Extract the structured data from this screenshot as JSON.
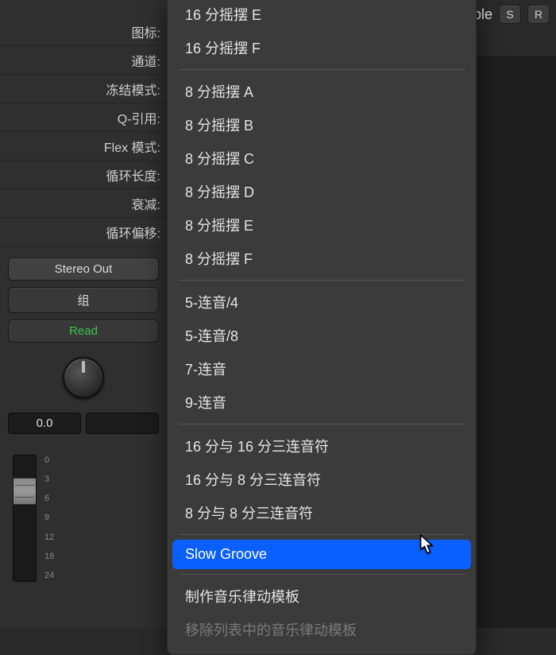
{
  "header": {
    "partial_title": "nt Maple",
    "solo_label": "S",
    "record_label": "R"
  },
  "panel": {
    "labels": {
      "icon": "图标:",
      "channel": "通道:",
      "freeze_mode": "冻结模式:",
      "q_reference": "Q-引用:",
      "flex_mode": "Flex 模式:",
      "loop_length": "循环长度:",
      "decay": "衰减:",
      "loop_offset": "循环偏移:"
    },
    "buttons": {
      "stereo_out": "Stereo Out",
      "group": "组",
      "read": "Read"
    },
    "value_box": "0.0",
    "ruler": [
      "0",
      "3",
      "6",
      "9",
      "12",
      "18",
      "24"
    ]
  },
  "menu": {
    "groups": [
      {
        "items": [
          "16 分摇摆 E",
          "16 分摇摆 F"
        ]
      },
      {
        "items": [
          "8 分摇摆 A",
          "8 分摇摆 B",
          "8 分摇摆 C",
          "8 分摇摆 D",
          "8 分摇摆 E",
          "8 分摇摆 F"
        ]
      },
      {
        "items": [
          "5-连音/4",
          "5-连音/8",
          "7-连音",
          "9-连音"
        ]
      },
      {
        "items": [
          "16 分与 16 分三连音符",
          "16 分与 8 分三连音符",
          "8 分与 8 分三连音符"
        ]
      },
      {
        "items": [
          "Slow Groove"
        ],
        "highlight": 0
      },
      {
        "items": [
          "制作音乐律动模板",
          "移除列表中的音乐律动模板"
        ],
        "disabled": [
          1
        ]
      }
    ]
  }
}
